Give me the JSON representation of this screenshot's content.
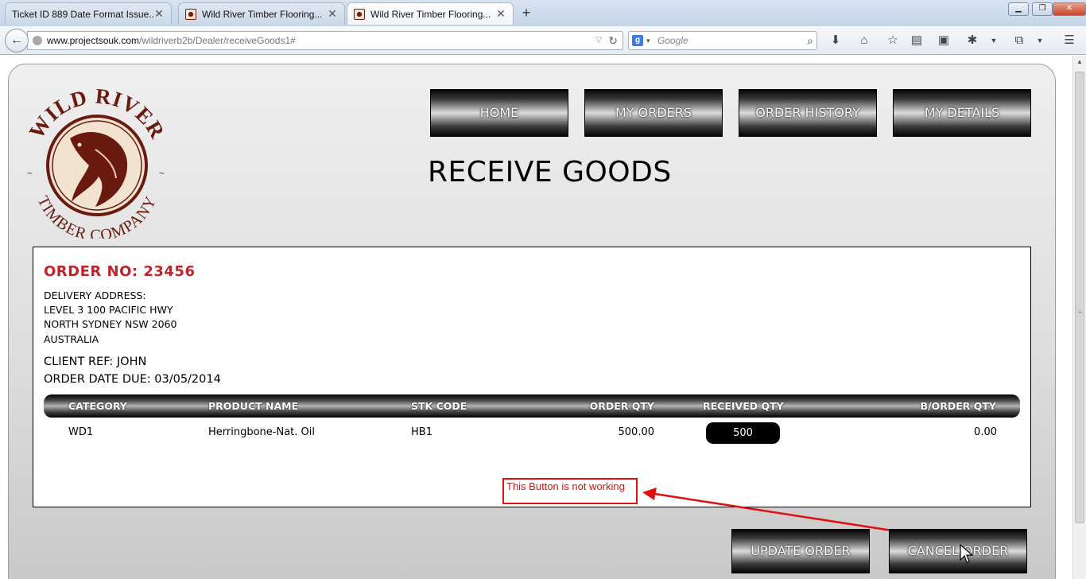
{
  "browser": {
    "tabs": [
      {
        "title": "Ticket ID 889 Date Format Issue..."
      },
      {
        "title": "Wild River Timber Flooring..."
      },
      {
        "title": "Wild River Timber Flooring..."
      }
    ],
    "url_domain": "www.projectsouk.com",
    "url_path": "/wildriverb2b/Dealer/receiveGoods1#",
    "search_placeholder": "Google"
  },
  "logo": {
    "top_text": "WILD RIVER",
    "bottom_text": "TIMBER COMPANY"
  },
  "nav": {
    "items": [
      "HOME",
      "MY ORDERS",
      "ORDER HISTORY",
      "MY DETAILS"
    ]
  },
  "page": {
    "title": "RECEIVE GOODS"
  },
  "order": {
    "order_no": "ORDER NO: 23456",
    "address_label": "DELIVERY ADDRESS:",
    "address_lines": [
      "LEVEL 3 100 PACIFIC HWY",
      "NORTH SYDNEY NSW 2060",
      "AUSTRALIA"
    ],
    "client_ref": "CLIENT REF: JOHN",
    "order_date_due": "ORDER DATE DUE: 03/05/2014"
  },
  "table": {
    "headers": [
      "CATEGORY",
      "PRODUCT NAME",
      "STK CODE",
      "ORDER QTY",
      "RECEIVED QTY",
      "B/ORDER QTY"
    ],
    "rows": [
      {
        "category": "WD1",
        "product_name": "Herringbone-Nat. Oil",
        "stk_code": "HB1",
        "order_qty": "500.00",
        "received_qty": "500",
        "border_qty": "0.00"
      }
    ]
  },
  "annotation": {
    "text": "This Button is not working",
    "color": "#e01010"
  },
  "actions": {
    "update_label": "UPDATE ORDER",
    "cancel_label": "CANCEL ORDER"
  },
  "colors": {
    "order_no": "#c0232b",
    "logo_brown": "#6b1a0f"
  }
}
